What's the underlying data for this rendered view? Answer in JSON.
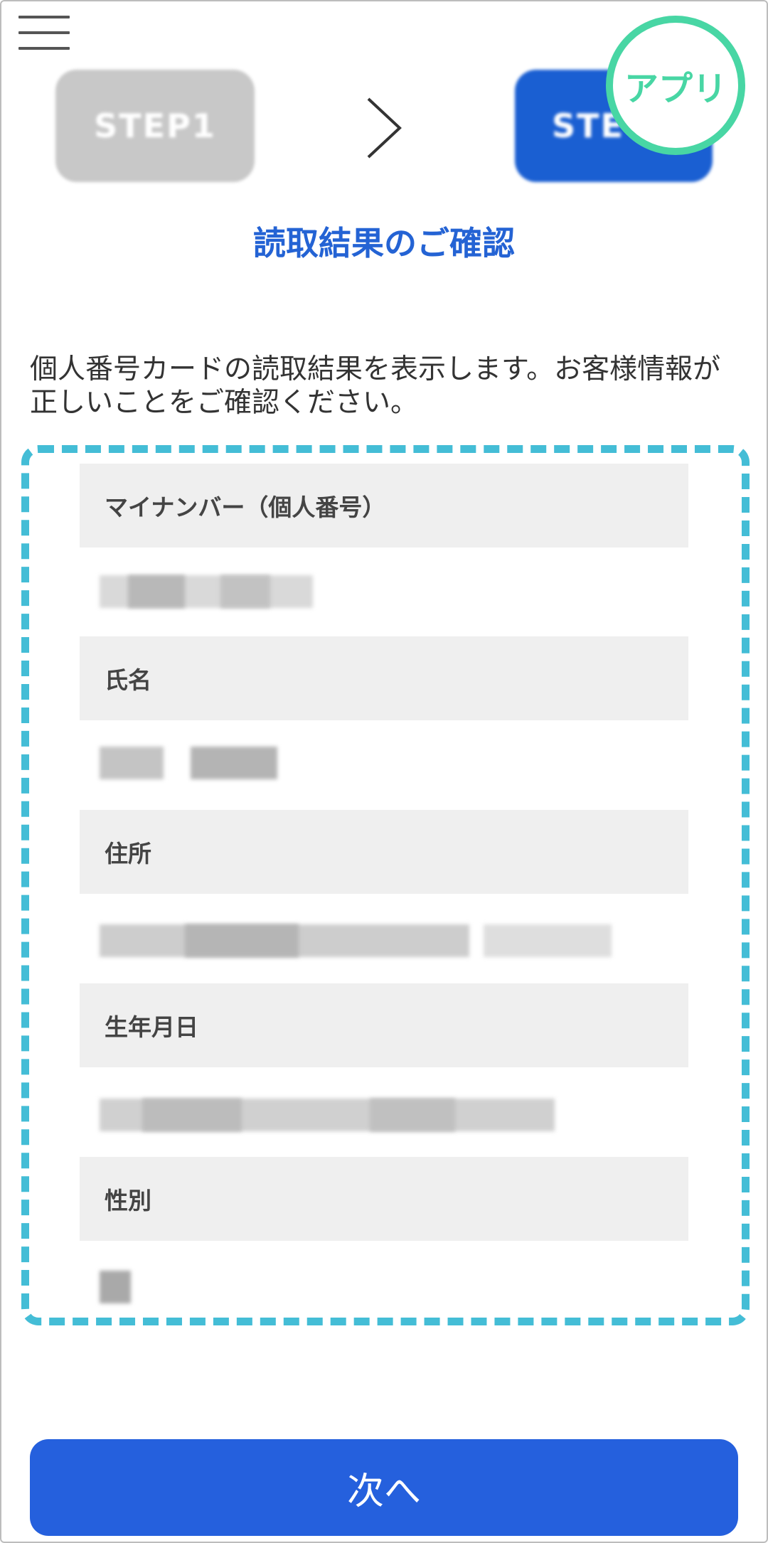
{
  "header": {
    "menu_icon": "hamburger-menu-icon",
    "steps": [
      {
        "label": "STEP1",
        "state": "done"
      },
      {
        "label": "STE",
        "state": "current"
      }
    ],
    "step_separator_icon": "chevron-right-icon",
    "app_badge_label": "アプリ"
  },
  "main": {
    "title": "読取結果のご確認",
    "intro": "個人番号カードの読取結果を表示します。お客様情報が正しいことをご確認ください。",
    "fields": [
      {
        "label": "マイナンバー（個人番号）"
      },
      {
        "label": "氏名"
      },
      {
        "label": "住所"
      },
      {
        "label": "生年月日"
      },
      {
        "label": "性別"
      }
    ]
  },
  "footer": {
    "next_label": "次へ"
  },
  "colors": {
    "accent_blue": "#2463d4",
    "button_blue": "#2560dd",
    "app_badge_green": "#48d6a4",
    "dashed_border": "#44bdd6",
    "label_bg": "#efefef"
  }
}
